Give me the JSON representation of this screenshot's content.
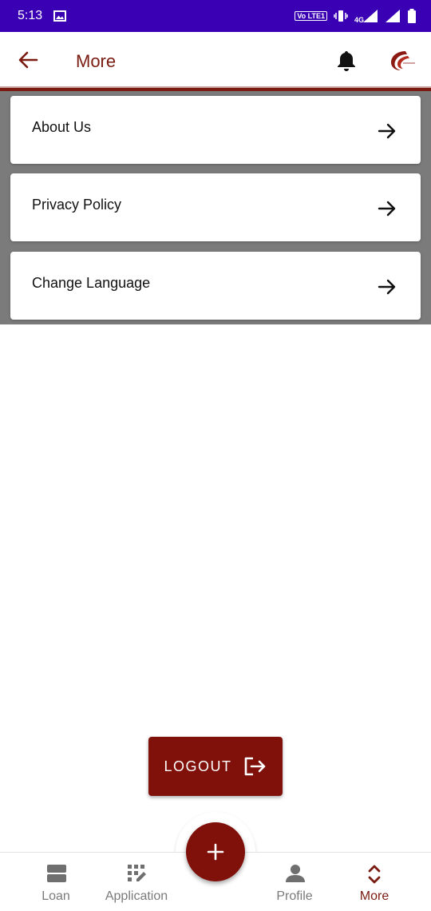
{
  "status_bar": {
    "time": "5:13",
    "network": "4G",
    "volte": "Vo LTE1"
  },
  "header": {
    "title": "More"
  },
  "menu": {
    "items": [
      {
        "label": "About Us"
      },
      {
        "label": "Privacy Policy"
      },
      {
        "label": "Change Language"
      }
    ]
  },
  "logout": {
    "label": "LOGOUT"
  },
  "bottom_nav": {
    "items": [
      {
        "label": "Loan",
        "icon": "loan-icon"
      },
      {
        "label": "Application",
        "icon": "application-icon"
      },
      {
        "label": "Profile",
        "icon": "profile-icon"
      },
      {
        "label": "More",
        "icon": "more-icon",
        "active": true
      }
    ],
    "fab_icon": "plus-icon"
  },
  "colors": {
    "status_bar": "#3a00b4",
    "brand": "#7f110a",
    "title": "#7a1b12",
    "overlay": "#7b7b7b"
  }
}
